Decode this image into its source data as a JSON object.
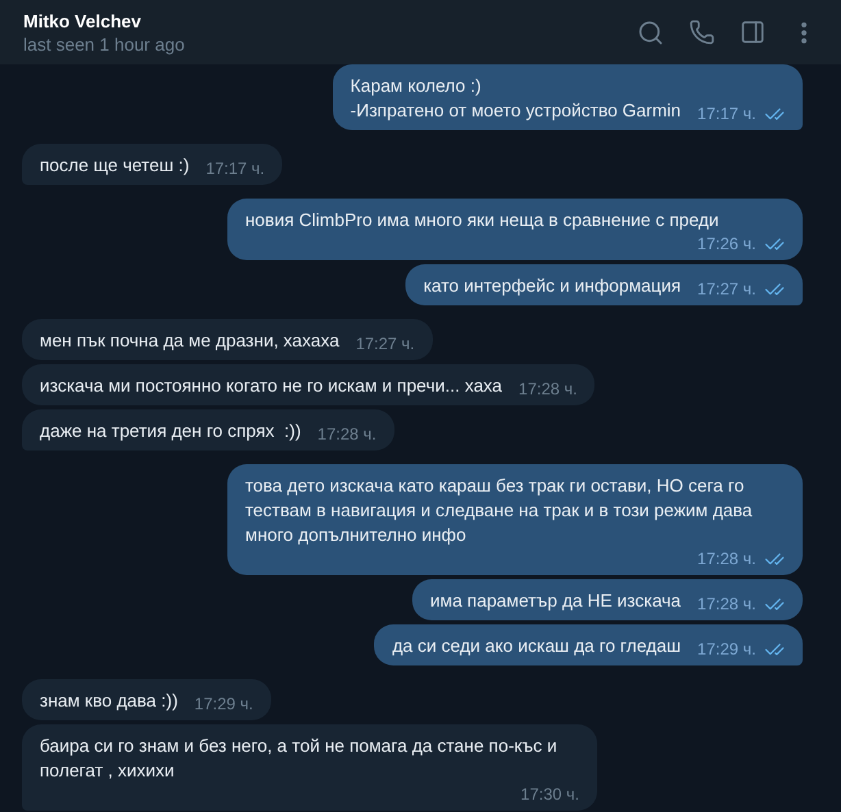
{
  "header": {
    "name": "Mitko Velchev",
    "status": "last seen 1 hour ago"
  },
  "messages": [
    {
      "kind": "outgoing",
      "text": "Карам колело :)\n-Изпратено от моето устройство Garmin",
      "time": "17:17 ч.",
      "read": true
    },
    {
      "kind": "incoming",
      "text": "после ще четеш :)",
      "time": "17:17 ч."
    },
    {
      "kind": "outgoing",
      "text": "новия ClimbPro има много яки неща в сравнение с преди",
      "time": "17:26 ч.",
      "read": true
    },
    {
      "kind": "outgoing",
      "text": "като интерфейс и информация",
      "time": "17:27 ч.",
      "read": true
    },
    {
      "kind": "incoming",
      "text": "мен пък почна да ме дразни, хахаха",
      "time": "17:27 ч."
    },
    {
      "kind": "incoming",
      "text": "изскача ми постоянно когато не го искам и пречи... хаха",
      "time": "17:28 ч."
    },
    {
      "kind": "incoming",
      "text": "даже на третия ден го спрях  :))",
      "time": "17:28 ч."
    },
    {
      "kind": "outgoing",
      "text": "това дето изскача като караш без трак ги остави, НО сега го тествам в навигация и следване на трак и в този режим дава много допълнително инфо",
      "time": "17:28 ч.",
      "read": true
    },
    {
      "kind": "outgoing",
      "text": "има параметър да НЕ изскача",
      "time": "17:28 ч.",
      "read": true
    },
    {
      "kind": "outgoing",
      "text": "да си седи ако искаш да го гледаш",
      "time": "17:29 ч.",
      "read": true
    },
    {
      "kind": "incoming",
      "text": "знам кво дава :))",
      "time": "17:29 ч."
    },
    {
      "kind": "incoming",
      "text": "баира си го знам и без него, а той не помага да стане по-къс и полегат , хихихи",
      "time": "17:30 ч."
    }
  ]
}
